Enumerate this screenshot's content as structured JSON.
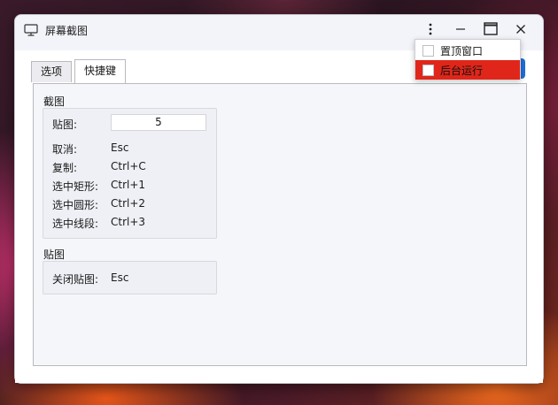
{
  "window": {
    "title": "屏幕截图",
    "controls": {
      "more_icon": "vertical-ellipsis-icon",
      "minimize_icon": "minimize-icon",
      "maximize_icon": "maximize-icon",
      "close_icon": "close-icon"
    }
  },
  "tabs": [
    {
      "label": "选项",
      "active": false
    },
    {
      "label": "快捷键",
      "active": true
    }
  ],
  "groups": {
    "screenshot": {
      "title": "截图",
      "rows": [
        {
          "label": "贴图:",
          "value": "5"
        },
        {
          "label": "取消:",
          "value": "Esc"
        },
        {
          "label": "复制:",
          "value": "Ctrl+C"
        },
        {
          "label": "选中矩形:",
          "value": "Ctrl+1"
        },
        {
          "label": "选中圆形:",
          "value": "Ctrl+2"
        },
        {
          "label": "选中线段:",
          "value": "Ctrl+3"
        }
      ]
    },
    "pin": {
      "title": "贴图",
      "rows": [
        {
          "label": "关闭贴图:",
          "value": "Esc"
        }
      ]
    }
  },
  "menu": {
    "items": [
      {
        "label": "置顶窗口",
        "checked": false,
        "highlighted": false
      },
      {
        "label": "后台运行",
        "checked": false,
        "highlighted": true
      }
    ]
  },
  "colors": {
    "highlight": "#e0261a",
    "accent": "#1f6fd6"
  }
}
